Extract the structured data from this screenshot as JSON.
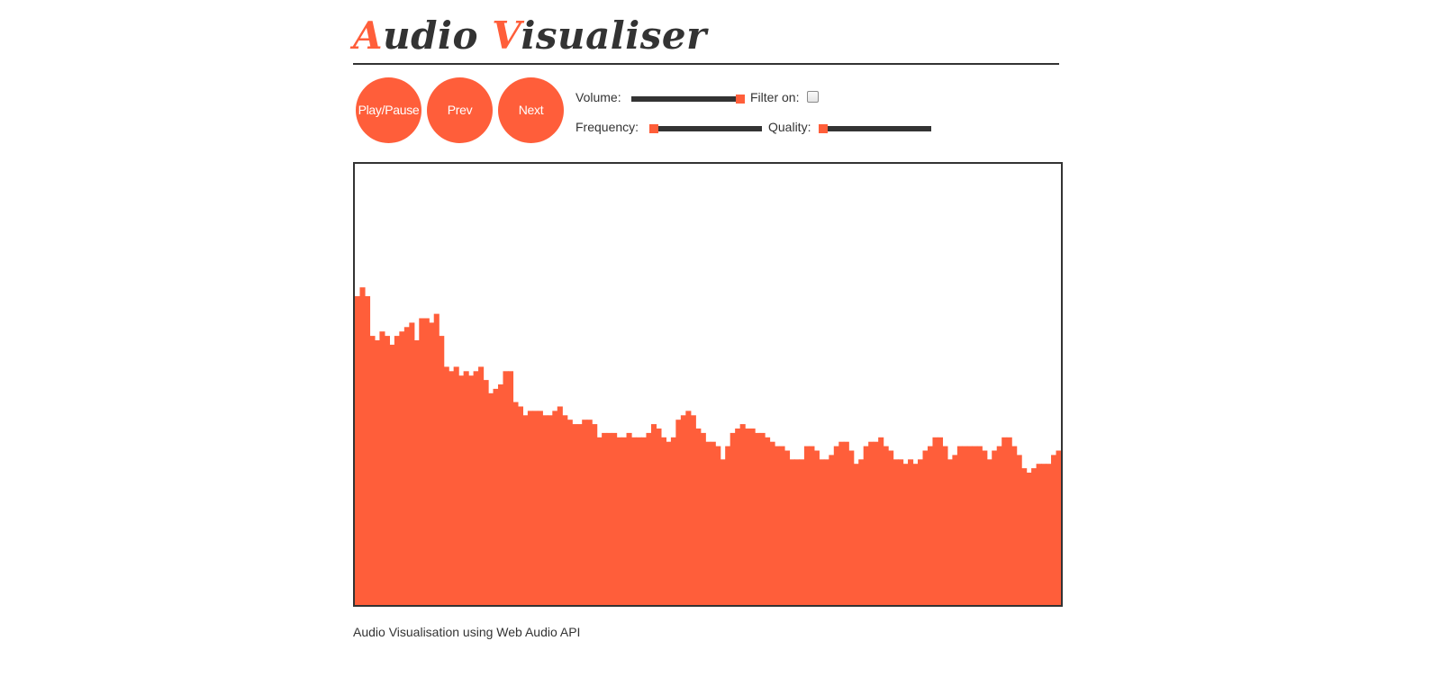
{
  "header": {
    "title_initial_1": "A",
    "title_rest_1": "udio ",
    "title_initial_2": "V",
    "title_rest_2": "isualiser"
  },
  "controls": {
    "play_pause_label": "Play/Pause",
    "prev_label": "Prev",
    "next_label": "Next",
    "volume_label": "Volume:",
    "volume_value": 1.0,
    "filter_label": "Filter on:",
    "filter_checked": false,
    "frequency_label": "Frequency:",
    "frequency_value": 0.0,
    "quality_label": "Quality:",
    "quality_value": 0.0
  },
  "colors": {
    "accent": "#ff5e3a",
    "text": "#333333",
    "slider_track": "#333333",
    "background": "#ffffff"
  },
  "visualiser": {
    "bar_levels": [
      0.7,
      0.72,
      0.7,
      0.61,
      0.6,
      0.62,
      0.61,
      0.59,
      0.61,
      0.62,
      0.63,
      0.64,
      0.6,
      0.65,
      0.65,
      0.64,
      0.66,
      0.61,
      0.54,
      0.53,
      0.54,
      0.52,
      0.53,
      0.52,
      0.53,
      0.54,
      0.51,
      0.48,
      0.49,
      0.5,
      0.53,
      0.53,
      0.46,
      0.45,
      0.43,
      0.44,
      0.44,
      0.44,
      0.43,
      0.43,
      0.44,
      0.45,
      0.43,
      0.42,
      0.41,
      0.41,
      0.42,
      0.42,
      0.41,
      0.38,
      0.39,
      0.39,
      0.39,
      0.38,
      0.38,
      0.39,
      0.38,
      0.38,
      0.38,
      0.39,
      0.41,
      0.4,
      0.38,
      0.37,
      0.38,
      0.42,
      0.43,
      0.44,
      0.43,
      0.4,
      0.39,
      0.37,
      0.37,
      0.36,
      0.33,
      0.36,
      0.39,
      0.4,
      0.41,
      0.4,
      0.4,
      0.39,
      0.39,
      0.38,
      0.37,
      0.36,
      0.36,
      0.35,
      0.33,
      0.33,
      0.33,
      0.36,
      0.36,
      0.35,
      0.33,
      0.33,
      0.34,
      0.36,
      0.37,
      0.37,
      0.35,
      0.32,
      0.33,
      0.36,
      0.37,
      0.37,
      0.38,
      0.36,
      0.35,
      0.33,
      0.33,
      0.32,
      0.33,
      0.32,
      0.33,
      0.35,
      0.36,
      0.38,
      0.38,
      0.36,
      0.33,
      0.34,
      0.36,
      0.36,
      0.36,
      0.36,
      0.36,
      0.35,
      0.33,
      0.35,
      0.36,
      0.38,
      0.38,
      0.36,
      0.34,
      0.31,
      0.3,
      0.31,
      0.32,
      0.32,
      0.32,
      0.34,
      0.35
    ]
  },
  "footer": {
    "text": "Audio Visualisation using Web Audio API"
  }
}
